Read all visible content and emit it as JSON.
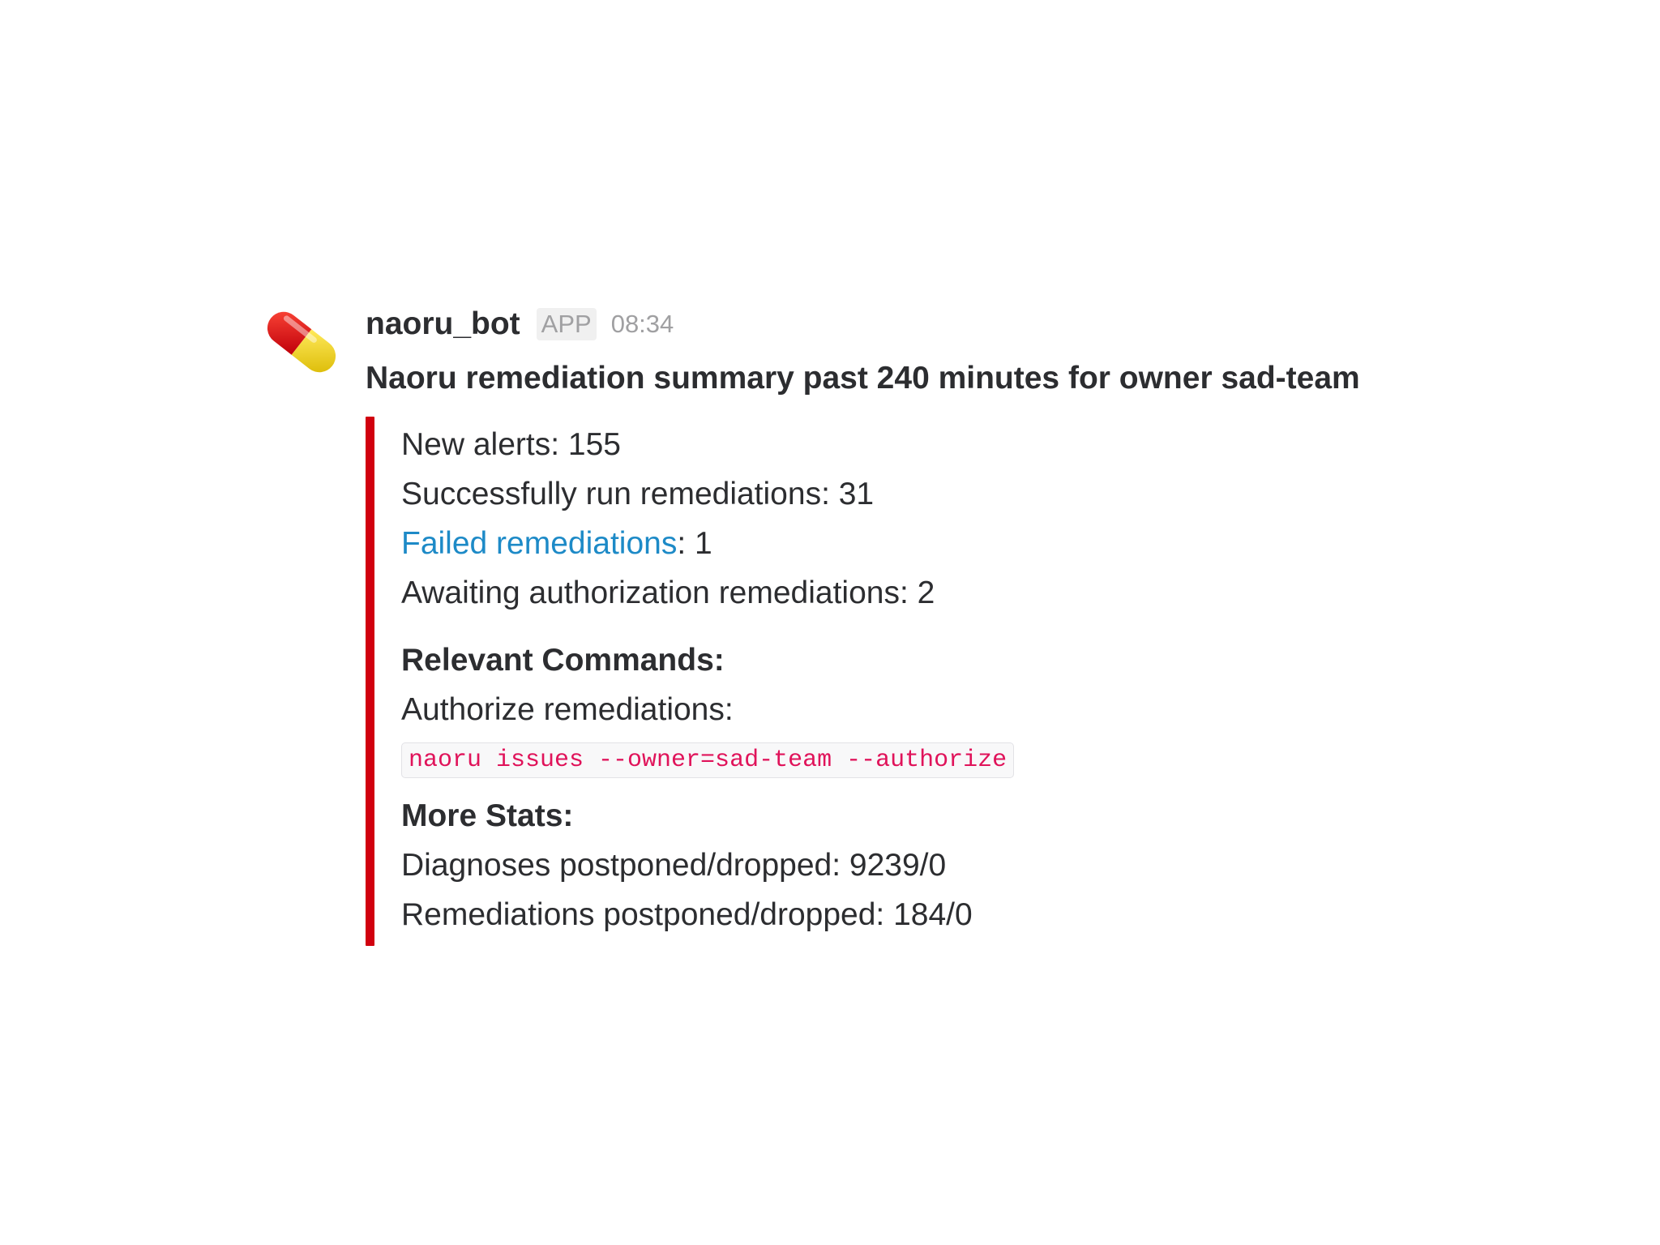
{
  "message": {
    "sender": "naoru_bot",
    "badge": "APP",
    "timestamp": "08:34",
    "avatar_icon": "pill-icon",
    "title": "Naoru remediation summary past 240 minutes for owner sad-team"
  },
  "attachment": {
    "bar_color": "#d1000f",
    "stats": {
      "new_alerts": "New alerts: 155",
      "successful": "Successfully run remediations: 31",
      "failed_label": "Failed remediations",
      "failed_value": ": 1",
      "awaiting": "Awaiting authorization remediations: 2"
    },
    "commands": {
      "heading": "Relevant Commands:",
      "authorize_label": "Authorize remediations:",
      "authorize_command": "naoru issues --owner=sad-team --authorize"
    },
    "more_stats": {
      "heading": "More Stats:",
      "diagnoses": "Diagnoses postponed/dropped: 9239/0",
      "remediations": "Remediations postponed/dropped: 184/0"
    }
  }
}
